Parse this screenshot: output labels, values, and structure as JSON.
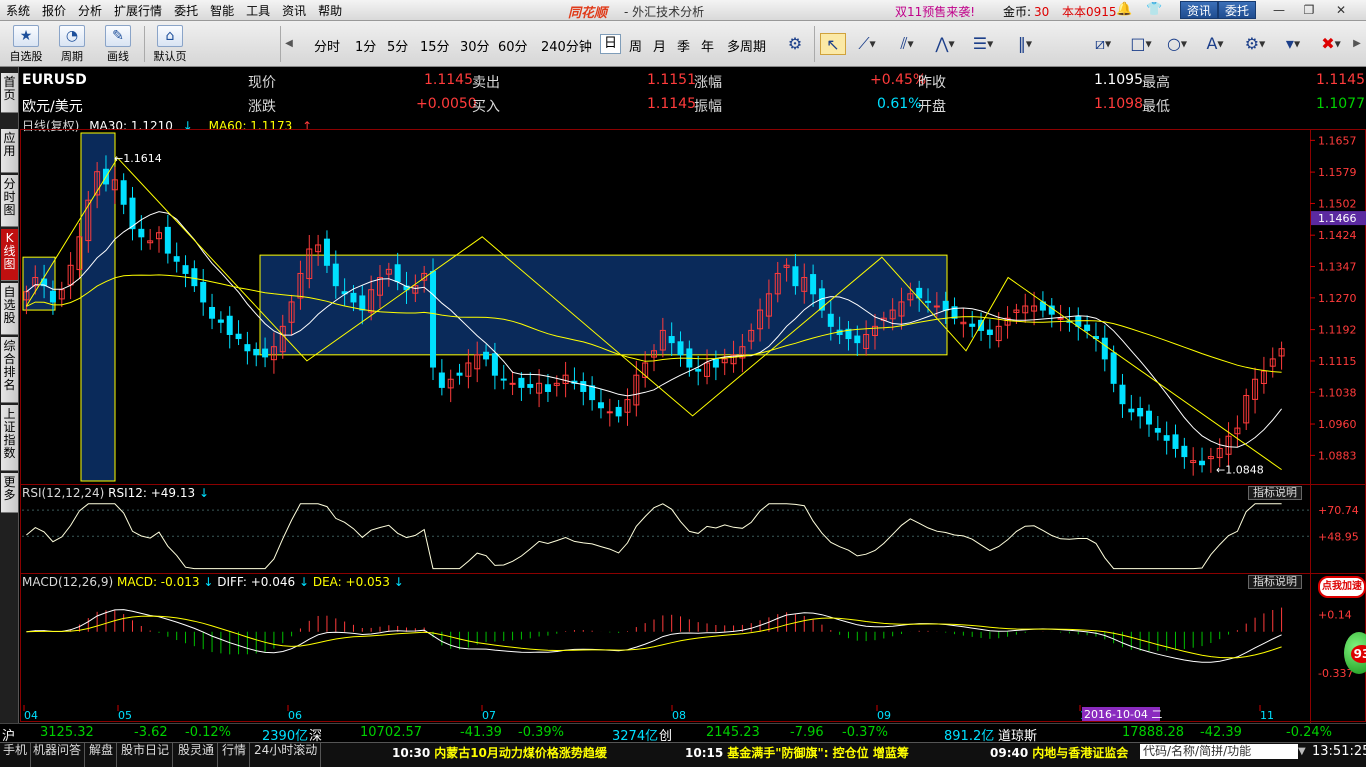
{
  "menu": [
    "系统",
    "报价",
    "分析",
    "扩展行情",
    "委托",
    "智能",
    "工具",
    "资讯",
    "帮助"
  ],
  "brand": "同花顺",
  "app_title": "- 外汇技术分析",
  "promo": "双11预售来袭!",
  "coins_label": "金币:",
  "coins_value": "30",
  "version": "本本0915",
  "menu_buttons": {
    "news": "资讯",
    "trade": "委托"
  },
  "toolbar": {
    "big": [
      {
        "label": "自选股",
        "icon": "★"
      },
      {
        "label": "周期",
        "icon": "◔"
      },
      {
        "label": "画线",
        "icon": "✎"
      },
      {
        "label": "默认页",
        "icon": "⌂"
      }
    ],
    "periods": [
      "分时",
      "1分",
      "5分",
      "15分",
      "30分",
      "60分",
      "240分钟",
      "日",
      "周",
      "月",
      "季",
      "年",
      "多周期"
    ],
    "selected_period": "日"
  },
  "left_tabs": [
    "首页",
    "应用",
    "分时图",
    "K线图",
    "自选股",
    "综合排名",
    "上证指数",
    "更多"
  ],
  "quote": {
    "symbol": "EURUSD",
    "name": "欧元/美元",
    "rows": [
      [
        {
          "label": "现价",
          "value": "1.1145"
        },
        {
          "label": "卖出",
          "value": "1.1151"
        },
        {
          "label": "涨幅",
          "value": "+0.45%"
        },
        {
          "label": "昨收",
          "value": "1.1095"
        },
        {
          "label": "最高",
          "value": "1.1145"
        }
      ],
      [
        {
          "label": "涨跌",
          "value": "+0.0050"
        },
        {
          "label": "买入",
          "value": "1.1145"
        },
        {
          "label": "振幅",
          "value": "0.61%"
        },
        {
          "label": "开盘",
          "value": "1.1098"
        },
        {
          "label": "最低",
          "value": "1.1077"
        }
      ]
    ]
  },
  "ma_line": {
    "period": "日线(复权)",
    "ma30": "MA30: 1.1210",
    "ma30_arrow": "↓",
    "ma60": "MA60: 1.1173",
    "ma60_arrow": "↑"
  },
  "rsi_line": {
    "title": "RSI(12,12,24)",
    "value": "RSI12: +49.13",
    "arrow": "↓"
  },
  "macd_line": {
    "title": "MACD(12,26,9)",
    "macd": "MACD: -0.013",
    "macd_arrow": "↓",
    "diff": "DIFF: +0.046",
    "diff_arrow": "↓",
    "dea": "DEA: +0.053",
    "dea_arrow": "↓"
  },
  "indicator_help": "指标说明",
  "badge": "点我加速",
  "ball": "93",
  "chart_data": [
    {
      "type": "candlestick",
      "series": [
        {
          "name": "EURUSD"
        },
        {
          "name": "MA30"
        },
        {
          "name": "MA60"
        }
      ],
      "y_ticks": [
        "1.1657",
        "1.1579",
        "1.1502",
        "1.1424",
        "1.1347",
        "1.1270",
        "1.1192",
        "1.1115",
        "1.1038",
        "1.0960",
        "1.0883"
      ],
      "ylim": [
        1.082,
        1.168
      ],
      "x_labels": [
        "04",
        "05",
        "06",
        "07",
        "08",
        "09",
        "10",
        "11"
      ],
      "high_annotation": "1.1614",
      "low_annotation": "1.0848",
      "current_price_tag": "1.1466",
      "date_tag": "2016-10-04 二",
      "closes": [
        1.1285,
        1.132,
        1.13,
        1.126,
        1.129,
        1.135,
        1.142,
        1.151,
        1.158,
        1.155,
        1.156,
        1.15,
        1.144,
        1.142,
        1.141,
        1.143,
        1.138,
        1.136,
        1.133,
        1.13,
        1.126,
        1.122,
        1.121,
        1.118,
        1.117,
        1.114,
        1.113,
        1.1125,
        1.115,
        1.12,
        1.126,
        1.133,
        1.139,
        1.14,
        1.135,
        1.13,
        1.128,
        1.126,
        1.124,
        1.129,
        1.132,
        1.134,
        1.131,
        1.129,
        1.13,
        1.133,
        1.11,
        1.105,
        1.107,
        1.108,
        1.111,
        1.113,
        1.112,
        1.108,
        1.107,
        1.106,
        1.105,
        1.105,
        1.106,
        1.104,
        1.106,
        1.108,
        1.106,
        1.104,
        1.102,
        1.1,
        1.099,
        1.098,
        1.102,
        1.108,
        1.111,
        1.114,
        1.119,
        1.116,
        1.113,
        1.11,
        1.109,
        1.111,
        1.11,
        1.112,
        1.113,
        1.115,
        1.119,
        1.124,
        1.128,
        1.133,
        1.135,
        1.13,
        1.132,
        1.128,
        1.124,
        1.12,
        1.118,
        1.117,
        1.116,
        1.118,
        1.12,
        1.122,
        1.124,
        1.126,
        1.128,
        1.127,
        1.126,
        1.125,
        1.124,
        1.122,
        1.121,
        1.12,
        1.119,
        1.118,
        1.12,
        1.122,
        1.124,
        1.125,
        1.125,
        1.124,
        1.123,
        1.122,
        1.121,
        1.12,
        1.119,
        1.117,
        1.112,
        1.106,
        1.101,
        1.099,
        1.098,
        1.096,
        1.094,
        1.092,
        1.09,
        1.088,
        1.087,
        1.086,
        1.088,
        1.09,
        1.093,
        1.095,
        1.103,
        1.107,
        1.109,
        1.112,
        1.1145
      ]
    },
    {
      "type": "line",
      "name": "RSI",
      "y_ticks": [
        "+70.74",
        "+48.95"
      ],
      "ylim": [
        20,
        80
      ]
    },
    {
      "type": "bar+line",
      "name": "MACD",
      "y_ticks": [
        "+0.14",
        "-0.337"
      ],
      "ylim": [
        -0.6,
        0.35
      ]
    }
  ],
  "index_bar": [
    {
      "text": "沪",
      "color": "white"
    },
    {
      "text": "3125.32",
      "color": "green"
    },
    {
      "text": "-3.62",
      "color": "green"
    },
    {
      "text": "-0.12%",
      "color": "green"
    },
    {
      "text": "2390亿",
      "color": "cyan"
    },
    {
      "text": "深",
      "color": "white"
    },
    {
      "text": "10702.57",
      "color": "green"
    },
    {
      "text": "-41.39",
      "color": "green"
    },
    {
      "text": "-0.39%",
      "color": "green"
    },
    {
      "text": "3274亿",
      "color": "cyan"
    },
    {
      "text": "创",
      "color": "white"
    },
    {
      "text": "2145.23",
      "color": "green"
    },
    {
      "text": "-7.96",
      "color": "green"
    },
    {
      "text": "-0.37%",
      "color": "green"
    },
    {
      "text": "891.2亿",
      "color": "cyan"
    },
    {
      "text": "道琼斯",
      "color": "white"
    },
    {
      "text": "17888.28",
      "color": "green"
    },
    {
      "text": "-42.39",
      "color": "green"
    },
    {
      "text": "-0.24%",
      "color": "green"
    }
  ],
  "status_tabs": [
    "手机",
    "机器问答",
    "解盘",
    "股市日记",
    "股灵通",
    "行情",
    "24小时滚动"
  ],
  "news": [
    {
      "time": "10:30",
      "text": "内蒙古10月动力煤价格涨势趋缓"
    },
    {
      "time": "10:15",
      "text": "基金满手\"防御旗\": 控仓位 增蓝筹"
    },
    {
      "time": "09:40",
      "text": "内地与香港证监会"
    }
  ],
  "code_placeholder": "代码/名称/简拼/功能",
  "clock": "13:51:25",
  "colors": {
    "up": "#ff3b3b",
    "down": "#00e0ff",
    "ma30": "#ffffff",
    "ma60": "#ffff00",
    "macd_pos": "#ff3b3b",
    "macd_neg": "#00c000",
    "highlight": "#0a2a5a"
  }
}
